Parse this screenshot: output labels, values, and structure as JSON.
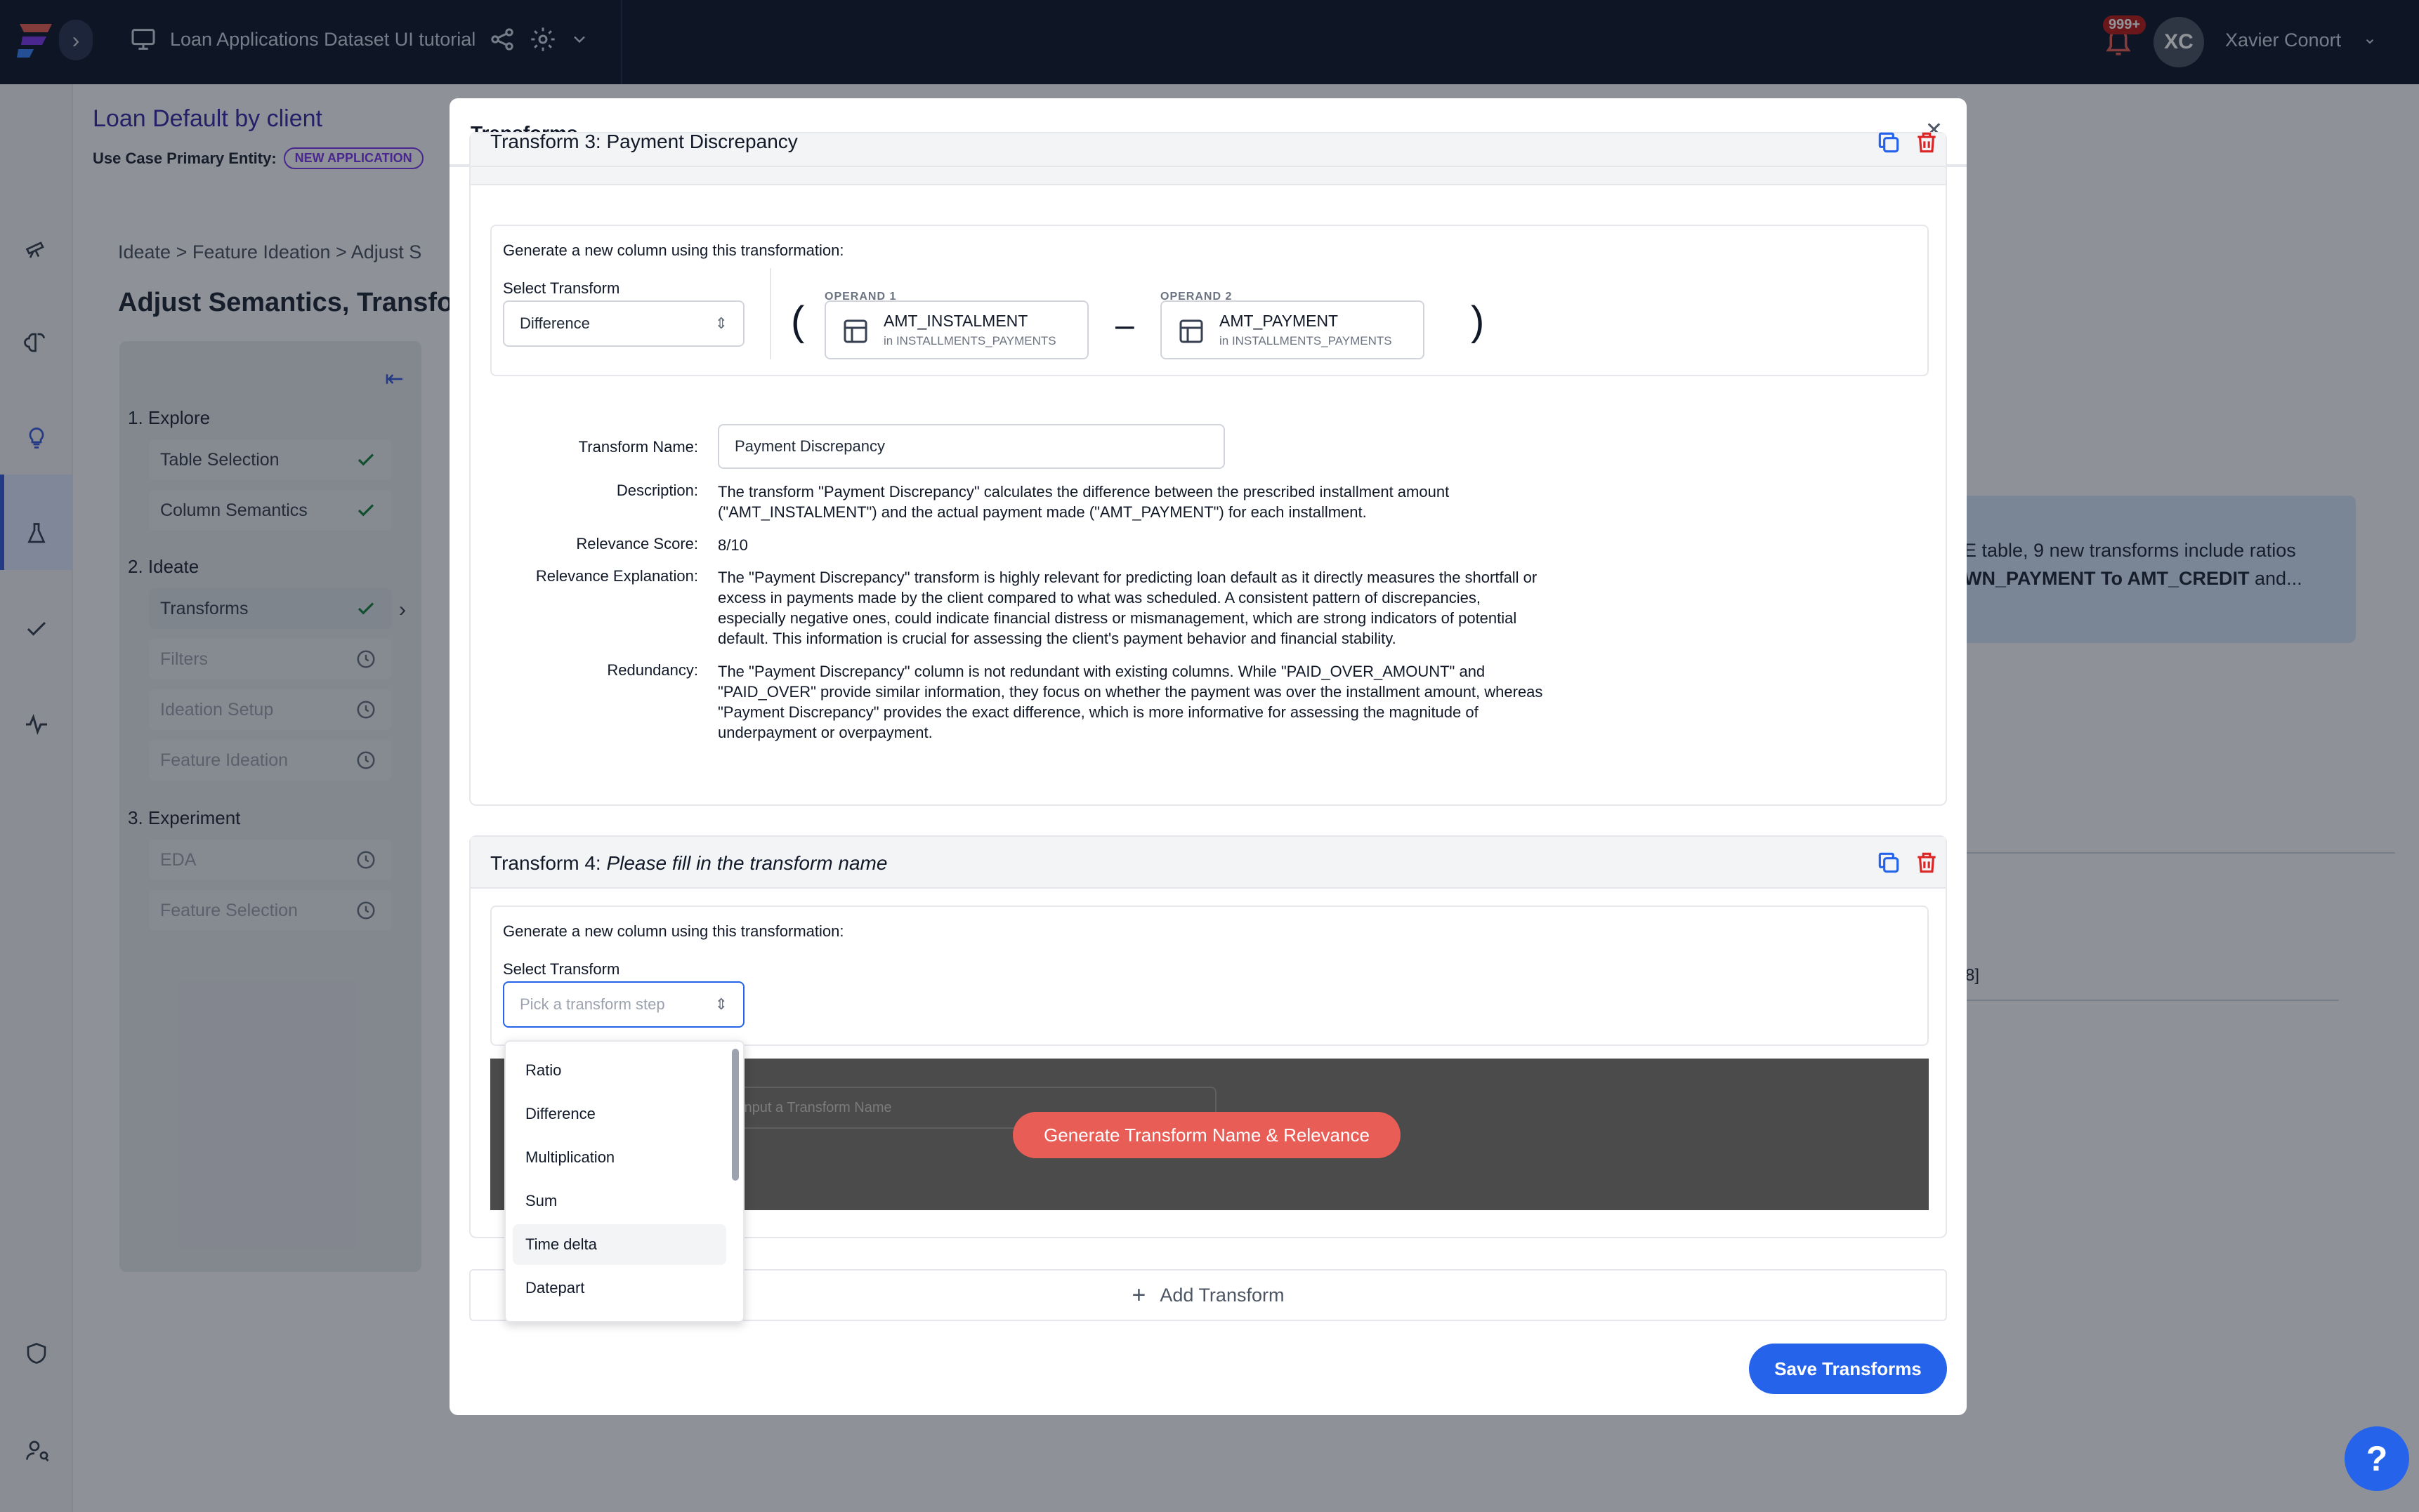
{
  "topbar": {
    "project_name": "Loan Applications Dataset UI tutorial",
    "notification_count": "999+",
    "user_initials": "XC",
    "user_name": "Xavier Conort"
  },
  "background": {
    "use_case_title": "Loan Default by client",
    "entity_label": "Use Case Primary Entity:",
    "entity_badge": "NEW APPLICATION",
    "breadcrumb": "Ideate  >  Feature Ideation  >  Adjust S",
    "page_heading": "Adjust Semantics, Transfor",
    "sections": [
      {
        "label": "1. Explore",
        "steps": [
          {
            "label": "Table Selection",
            "status": "done"
          },
          {
            "label": "Column Semantics",
            "status": "done"
          }
        ]
      },
      {
        "label": "2. Ideate",
        "steps": [
          {
            "label": "Transforms",
            "status": "done"
          },
          {
            "label": "Filters",
            "status": "pending"
          },
          {
            "label": "Ideation Setup",
            "status": "pending"
          },
          {
            "label": "Feature Ideation",
            "status": "pending"
          }
        ]
      },
      {
        "label": "3. Experiment",
        "steps": [
          {
            "label": "EDA",
            "status": "pending"
          },
          {
            "label": "Feature Selection",
            "status": "pending"
          }
        ]
      }
    ],
    "info_line1": "E table, 9 new transforms include ratios",
    "info_line2_bold": "WN_PAYMENT To AMT_CREDIT",
    "info_line2_rest": " and...",
    "fragment_tag": "8]"
  },
  "modal": {
    "title": "Transforms",
    "transform3": {
      "header": "Transform 3: Payment Discrepancy",
      "generate_label": "Generate a new column using this transformation:",
      "select_label": "Select Transform",
      "selected": "Difference",
      "operand1_caption": "OPERAND 1",
      "operand1_name": "AMT_INSTALMENT",
      "operand1_source": "in INSTALLMENTS_PAYMENTS",
      "operand2_caption": "OPERAND 2",
      "operand2_name": "AMT_PAYMENT",
      "operand2_source": "in INSTALLMENTS_PAYMENTS",
      "name_label": "Transform Name:",
      "name_value": "Payment Discrepancy",
      "desc_label": "Description:",
      "desc_lines": [
        "The transform \"Payment Discrepancy\" calculates the difference between the prescribed installment amount",
        "(\"AMT_INSTALMENT\") and the actual payment made (\"AMT_PAYMENT\") for each installment."
      ],
      "score_label": "Relevance Score:",
      "score_value": "8/10",
      "expl_label": "Relevance Explanation:",
      "expl_lines": [
        "The \"Payment Discrepancy\" transform is highly relevant for predicting loan default as it directly measures the shortfall or",
        "excess in payments made by the client compared to what was scheduled. A consistent pattern of discrepancies,",
        "especially negative ones, could indicate financial distress or mismanagement, which are strong indicators of potential",
        "default. This information is crucial for assessing the client's payment behavior and financial stability."
      ],
      "redund_label": "Redundancy:",
      "redund_lines": [
        "The \"Payment Discrepancy\" column is not redundant with existing columns. While \"PAID_OVER_AMOUNT\" and",
        "\"PAID_OVER\" provide similar information, they focus on whether the payment was over the installment amount, whereas",
        "\"Payment Discrepancy\" provides the exact difference, which is more informative for assessing the magnitude of",
        "underpayment or overpayment."
      ]
    },
    "transform4": {
      "header_prefix": "Transform 4:",
      "header_placeholder": "Please fill in the transform name",
      "generate_label": "Generate a new column using this transformation:",
      "select_label": "Select Transform",
      "select_placeholder": "Pick a transform step",
      "name_placeholder": "Input a Transform Name",
      "generate_button": "Generate Transform Name & Relevance"
    },
    "dropdown_options": [
      "Ratio",
      "Difference",
      "Multiplication",
      "Sum",
      "Time delta",
      "Datepart"
    ],
    "hovered_option": "Time delta",
    "add_transform": "Add Transform",
    "save_button": "Save Transforms"
  },
  "help_label": "?",
  "colors": {
    "primary": "#2563eb",
    "danger": "#dc2626",
    "generate": "#e85d56",
    "topbar": "#111b2e"
  }
}
